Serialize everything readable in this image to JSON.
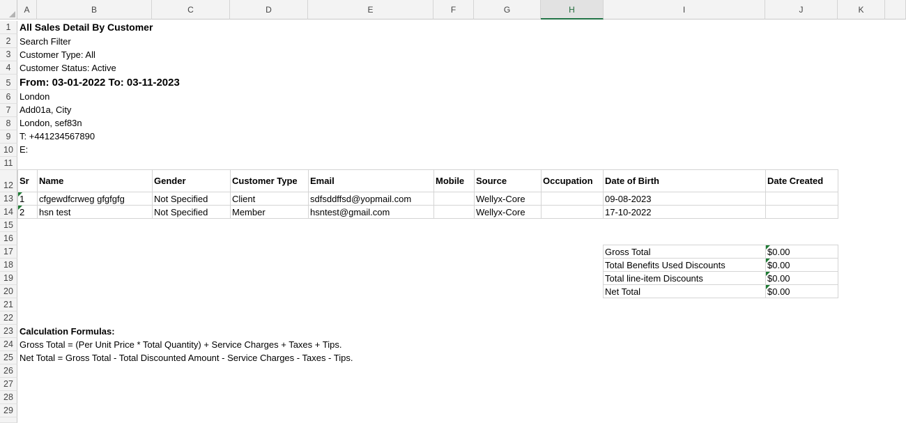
{
  "columns": [
    "A",
    "B",
    "C",
    "D",
    "E",
    "F",
    "G",
    "H",
    "I",
    "J",
    "K"
  ],
  "selected_column": "H",
  "rows": [
    "1",
    "2",
    "3",
    "4",
    "5",
    "6",
    "7",
    "8",
    "9",
    "10",
    "11",
    "12",
    "13",
    "14",
    "15",
    "16",
    "17",
    "18",
    "19",
    "20",
    "21",
    "22",
    "23",
    "24",
    "25",
    "26",
    "27",
    "28",
    "29"
  ],
  "header": {
    "title": "All Sales Detail By Customer",
    "search_filter": "Search Filter",
    "customer_type": "Customer Type: All",
    "customer_status": "Customer Status: Active",
    "date_range": "From: 03-01-2022 To: 03-11-2023",
    "location": "London",
    "address1": "Add01a, City",
    "address2": "London, sef83n",
    "phone": "T: +441234567890",
    "email": "E:"
  },
  "table": {
    "headers": [
      "Sr",
      "Name",
      "Gender",
      "Customer Type",
      "Email",
      "Mobile",
      "Source",
      "Occupation",
      "Date of Birth",
      "Date Created"
    ],
    "rows": [
      [
        "1",
        "cfgewdfcrweg gfgfgfg",
        "Not Specified",
        "Client",
        "sdfsddffsd@yopmail.com",
        "",
        "Wellyx-Core",
        "",
        "09-08-2023",
        ""
      ],
      [
        "2",
        "hsn test",
        "Not Specified",
        "Member",
        "hsntest@gmail.com",
        "",
        "Wellyx-Core",
        "",
        "17-10-2022",
        ""
      ]
    ]
  },
  "totals": [
    {
      "label": "Gross Total",
      "value": "$0.00"
    },
    {
      "label": "Total Benefits Used Discounts",
      "value": "$0.00"
    },
    {
      "label": "Total line-item Discounts",
      "value": "$0.00"
    },
    {
      "label": "Net Total",
      "value": "$0.00"
    }
  ],
  "formulas": {
    "heading": "Calculation Formulas:",
    "gross": "Gross Total = (Per Unit Price * Total Quantity) + Service Charges + Taxes + Tips.",
    "net": "Net Total = Gross Total - Total Discounted Amount - Service Charges - Taxes - Tips."
  },
  "colors": {
    "accent": "#217346",
    "flag": "#1e7b34",
    "grid": "#d4d4d4"
  }
}
